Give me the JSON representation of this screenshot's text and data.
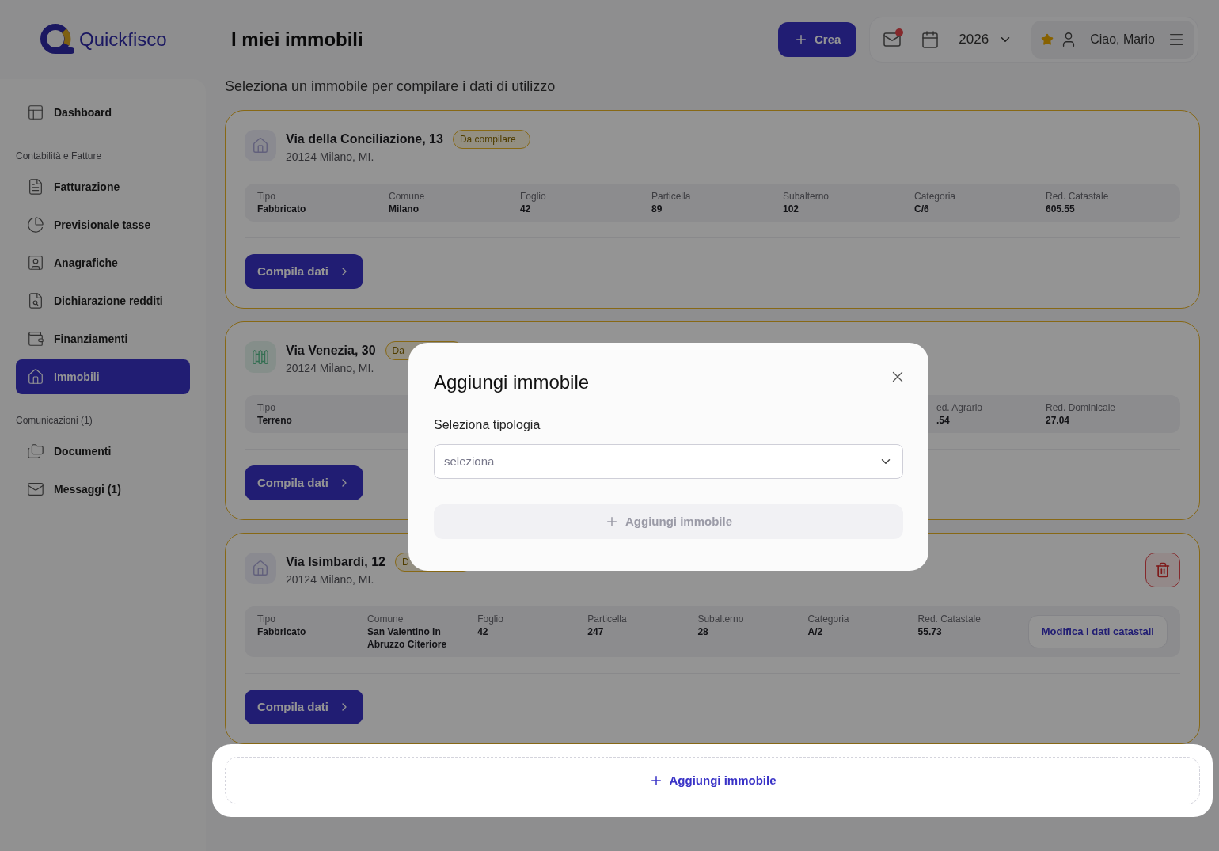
{
  "brand": {
    "name": "Quickfisco"
  },
  "page": {
    "title": "I miei immobili",
    "subtitle": "Seleziona un immobile per compilare i dati di utilizzo"
  },
  "header": {
    "create_button": "Crea",
    "mail_unread": true,
    "year": "2026",
    "greeting": "Ciao, Mario"
  },
  "sidebar": {
    "groups": [
      {
        "items": [
          {
            "label": "Dashboard",
            "selected": false
          }
        ]
      },
      {
        "heading": "Contabilità e Fatture",
        "items": [
          {
            "label": "Fatturazione",
            "selected": false
          },
          {
            "label": "Previsionale tasse",
            "selected": false
          },
          {
            "label": "Anagrafiche",
            "selected": false
          },
          {
            "label": "Dichiarazione redditi",
            "selected": false
          },
          {
            "label": "Finanziamenti",
            "selected": false
          },
          {
            "label": "Immobili",
            "selected": true
          }
        ]
      },
      {
        "heading": "Comunicazioni (1)",
        "items": [
          {
            "label": "Documenti",
            "selected": false
          },
          {
            "label": "Messaggi (1)",
            "selected": false
          }
        ]
      }
    ]
  },
  "properties": [
    {
      "kind": "fabbricato",
      "title": "Via della Conciliazione, 13",
      "address": "20124 Milano, MI.",
      "badge": "Da compilare",
      "deletable": false,
      "fields": [
        {
          "label": "Tipo",
          "value": "Fabbricato"
        },
        {
          "label": "Comune",
          "value": "Milano"
        },
        {
          "label": "Foglio",
          "value": "42"
        },
        {
          "label": "Particella",
          "value": "89"
        },
        {
          "label": "Subalterno",
          "value": "102"
        },
        {
          "label": "Categoria",
          "value": "C/6"
        },
        {
          "label": "Red. Catastale",
          "value": "605.55"
        }
      ],
      "action": "Compila dati"
    },
    {
      "kind": "terreno",
      "title": "Via Venezia, 30",
      "address": "20124 Milano, MI.",
      "badge": "Da",
      "deletable": false,
      "fields": [
        {
          "label": "Tipo",
          "value": "Terreno"
        },
        {
          "label": "ed. Agrario",
          "value": ".54"
        },
        {
          "label": "Red. Dominicale",
          "value": "27.04"
        }
      ],
      "action": "Compila dati"
    },
    {
      "kind": "fabbricato",
      "title": "Via Isimbardi, 12",
      "address": "20124 Milano, MI.",
      "badge": "D",
      "deletable": true,
      "fields": [
        {
          "label": "Tipo",
          "value": "Fabbricato"
        },
        {
          "label": "Comune",
          "value": "San Valentino in Abruzzo Citeriore"
        },
        {
          "label": "Foglio",
          "value": "42"
        },
        {
          "label": "Particella",
          "value": "247"
        },
        {
          "label": "Subalterno",
          "value": "28"
        },
        {
          "label": "Categoria",
          "value": "A/2"
        },
        {
          "label": "Red. Catastale",
          "value": "55.73"
        }
      ],
      "edit_link": "Modifica i dati catastali",
      "action": "Compila dati"
    }
  ],
  "add_card": {
    "label": "Aggiungi immobile"
  },
  "modal": {
    "title": "Aggiungi immobile",
    "field_label": "Seleziona tipologia",
    "select_placeholder": "seleziona",
    "submit": "Aggiungi immobile",
    "submit_disabled": true
  }
}
